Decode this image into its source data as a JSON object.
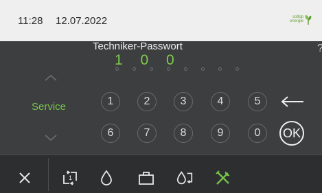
{
  "header": {
    "time": "11:28",
    "date": "12.07.2022",
    "logo_text": "soltop energie"
  },
  "help": {
    "label": "?"
  },
  "password": {
    "title": "Techniker-Passwort",
    "digits": "1 0 0"
  },
  "sidebar": {
    "label": "Service"
  },
  "keypad": {
    "row1": [
      "1",
      "2",
      "3",
      "4",
      "5"
    ],
    "row2": [
      "6",
      "7",
      "8",
      "9",
      "0"
    ],
    "ok_label": "OK"
  },
  "toolbar": {
    "items": [
      "close-icon",
      "transfer-icon",
      "water-drop-icon",
      "case-icon",
      "cycle-icon",
      "service-tools-icon"
    ]
  },
  "colors": {
    "accent": "#77c34b",
    "background": "#3d3e40",
    "header_bg": "#efefef",
    "toolbar_bg": "#2d2e30"
  }
}
